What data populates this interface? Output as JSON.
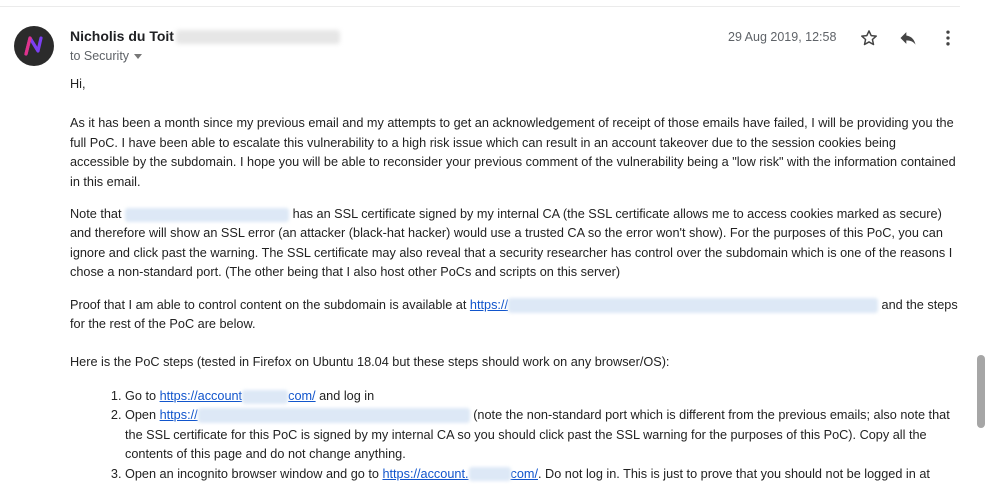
{
  "email": {
    "sender_name": "Nicholis du Toit",
    "to_line": "to Security",
    "date": "29 Aug 2019, 12:58"
  },
  "icons": {
    "avatar": "avatar-n-logo",
    "star": "star-icon",
    "reply": "reply-icon",
    "more": "more-vertical-icon",
    "caret": "chevron-down-icon"
  },
  "colors": {
    "link": "#1155cc",
    "avatar_bg": "#2b2b2b",
    "avatar_letter": "#7b3ff2"
  },
  "content": {
    "greeting": "Hi,",
    "p1": "As it has been a month since my previous email and my attempts to get an acknowledgement of receipt of those emails have failed, I will be providing you the full PoC. I have been able to escalate this vulnerability to a high risk issue which can result in an account takeover due to the session cookies being accessible by the subdomain. I hope you will be able to reconsider your previous comment of the vulnerability being a \"low risk\" with the information contained in this email.",
    "p2_prefix": "Note that",
    "p2_rest": "has an SSL certificate signed by my internal CA (the SSL certificate allows me to access cookies marked as secure) and therefore will show an SSL error (an attacker (black-hat hacker) would use a trusted CA so the error won't show). For the purposes of this PoC, you can ignore and click past the warning. The SSL certificate may also reveal that a security researcher has control over the subdomain which is one of the reasons I chose a non-standard port. (The other being that I also host other PoCs and scripts on this server)",
    "p3_prefix": "Proof that I am able to control content on the subdomain is available at",
    "p3_link": "https://",
    "p3_suffix": "and the steps for the rest of the PoC are below.",
    "p4": "Here is the PoC steps (tested in Firefox on Ubuntu 18.04 but these steps should work on any browser/OS):",
    "steps": {
      "s1_prefix": "Go to",
      "s1_link_a": "https://account",
      "s1_link_b": "com/",
      "s1_suffix": "and log in",
      "s2_prefix": "Open",
      "s2_link": "https://",
      "s2_rest": "(note the non-standard port which is different from the previous emails; also note that the SSL certificate for this PoC is signed by my internal CA so you should click past the SSL warning for the purposes of this PoC). Copy all the contents of this page and do not change anything.",
      "s3_prefix": "Open an incognito browser window and go to",
      "s3_link_a": "https://account.",
      "s3_link_b": "com/",
      "s3_rest": ". Do not log in. This is just to prove that you should not be logged in at"
    }
  }
}
